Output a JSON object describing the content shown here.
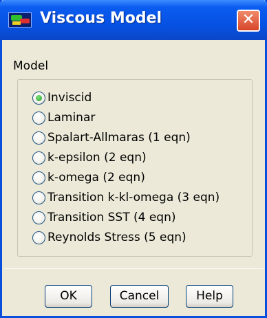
{
  "window": {
    "title": "Viscous Model",
    "close_glyph": "✕"
  },
  "model": {
    "group_label": "Model",
    "options": [
      {
        "label": "Inviscid",
        "selected": true
      },
      {
        "label": "Laminar",
        "selected": false
      },
      {
        "label": "Spalart-Allmaras (1 eqn)",
        "selected": false
      },
      {
        "label": "k-epsilon (2 eqn)",
        "selected": false
      },
      {
        "label": "k-omega (2 eqn)",
        "selected": false
      },
      {
        "label": "Transition k-kl-omega (3 eqn)",
        "selected": false
      },
      {
        "label": "Transition SST (4 eqn)",
        "selected": false
      },
      {
        "label": "Reynolds Stress (5 eqn)",
        "selected": false
      }
    ]
  },
  "buttons": {
    "ok": "OK",
    "cancel": "Cancel",
    "help": "Help"
  },
  "colors": {
    "titlebar": "#0652e4",
    "dialog_bg": "#ece9d8",
    "close": "#d8452a",
    "radio_selected": "#21a121"
  }
}
